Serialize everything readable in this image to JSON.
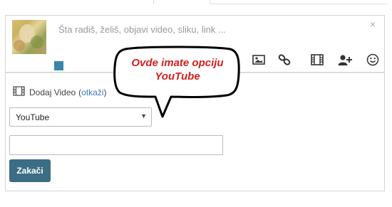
{
  "composer": {
    "placeholder": "Šta radiš, želiš, objavi video, sliku, link ...",
    "close_glyph": "×",
    "tools": [
      "image-icon",
      "link-icon",
      "film-icon",
      "add-user-icon",
      "smiley-icon"
    ]
  },
  "video_panel": {
    "title": "Dodaj Video",
    "cancel_label": "otkaži",
    "open_paren": "(",
    "close_paren": ")",
    "select_value": "YouTube",
    "url_value": "",
    "submit_label": "Zakači"
  },
  "callout": {
    "text": "Ovde imate opciju\nYouTube",
    "color": "#d21f1f"
  },
  "colors": {
    "accent_square": "#3a86a8",
    "button": "#3b6d84",
    "link": "#3b7dba"
  }
}
